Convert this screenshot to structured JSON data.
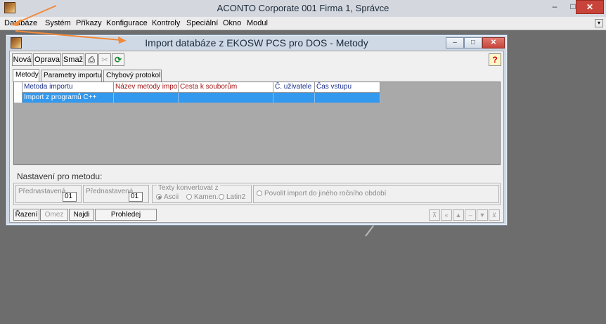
{
  "app": {
    "title": "ACONTO Corporate 001 Firma 1, Správce",
    "controls": {
      "minimize": "–",
      "maximize": "□",
      "close": "✕"
    },
    "menu": [
      "Databáze",
      "Systém",
      "Příkazy",
      "Konfigurace",
      "Kontroly",
      "Speciální",
      "Okno",
      "Modul"
    ]
  },
  "child": {
    "title": "Import databáze z EKOSW PCS pro DOS - Metody",
    "toolbar": {
      "new": "Nová",
      "edit": "Oprava",
      "delete": "Smaž",
      "help": "?"
    },
    "tabs": [
      "Metody",
      "Parametry importu",
      "Chybový protokol"
    ],
    "grid": {
      "columns": [
        "Metoda importu",
        "Název metody importu",
        "Cesta k souborům",
        "Č. uživatele",
        "Čas vstupu"
      ],
      "rows": [
        [
          "Import z programů C++",
          "",
          "",
          "",
          ""
        ]
      ]
    },
    "settings": {
      "section_title": "Nastavení pro metodu:",
      "preset1_label": "Přednastavená",
      "preset1_value": "01",
      "preset2_label": "Přednastavená",
      "preset2_value": "01",
      "texts_group_label": "Texty konvertovat z",
      "radio_ascii": "Ascii",
      "radio_kamen": "Kamen.",
      "radio_latin2": "Latin2",
      "allow_import_label": "Povolit import do jiného ročního období"
    },
    "bottom": {
      "sort": "Řazení",
      "limit": "Omez",
      "find": "Najdi",
      "browse": "Prohledej"
    }
  },
  "colors": {
    "selection": "#3399ee",
    "window_close": "#c8443a",
    "arrow": "#f08a3c",
    "workspace": "#6d6d6d"
  }
}
